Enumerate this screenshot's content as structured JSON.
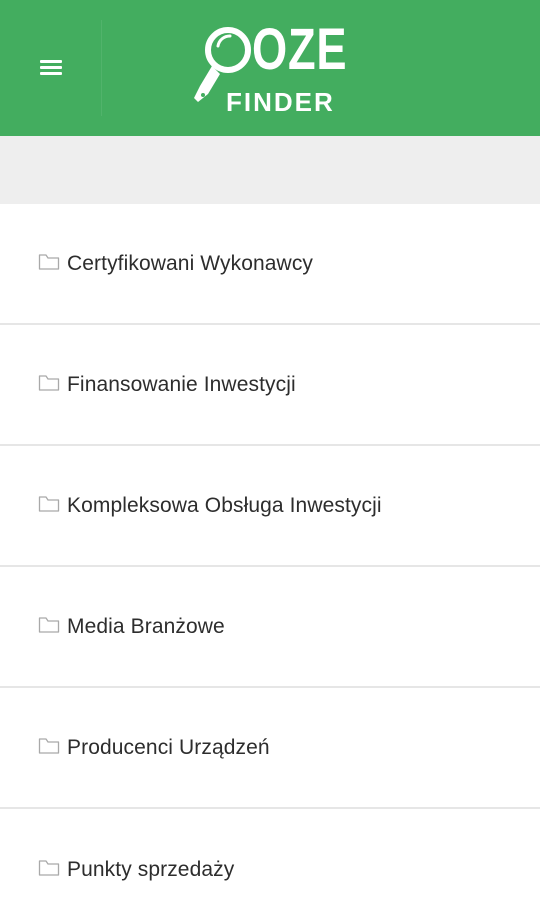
{
  "header": {
    "menu_icon": "hamburger-menu-icon",
    "logo": {
      "top_text": "OZE",
      "bottom_text": "FINDER",
      "mark": "magnifier-tag-icon"
    }
  },
  "categories": [
    {
      "label": "Certyfikowani Wykonawcy",
      "icon": "folder-icon"
    },
    {
      "label": "Finansowanie Inwestycji",
      "icon": "folder-icon"
    },
    {
      "label": "Kompleksowa Obsługa Inwestycji",
      "icon": "folder-icon"
    },
    {
      "label": "Media Branżowe",
      "icon": "folder-icon"
    },
    {
      "label": "Producenci Urządzeń",
      "icon": "folder-icon"
    },
    {
      "label": "Punkty sprzedaży",
      "icon": "folder-icon"
    }
  ],
  "colors": {
    "header_bg": "#43ad5f",
    "subbar_bg": "#eeeeee",
    "text": "#2d2d2d",
    "divider": "#e6e6e6"
  }
}
